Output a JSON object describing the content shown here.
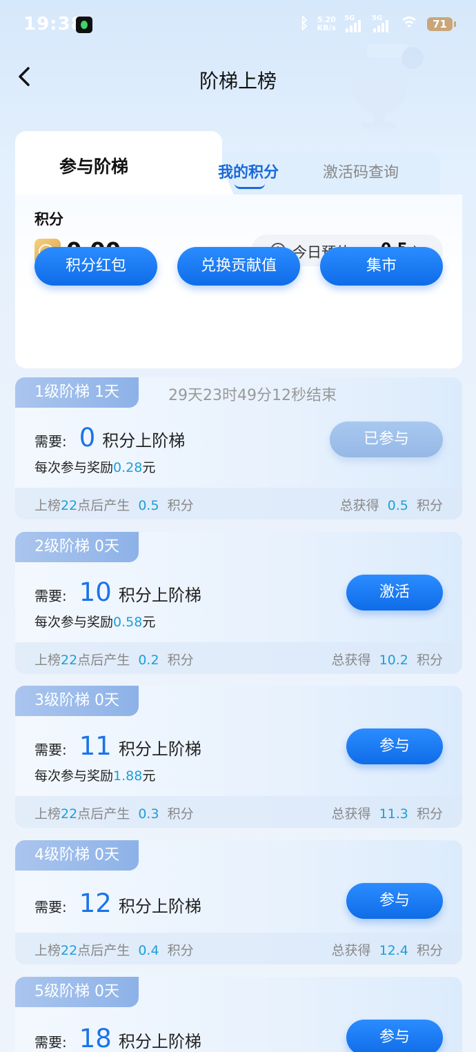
{
  "status": {
    "time": "19:38",
    "speed_top": "5.20",
    "speed_bottom": "KB/s",
    "sig1": "5G",
    "sig2": "5G",
    "battery": "71"
  },
  "header": {
    "title": "阶梯上榜"
  },
  "tabs": [
    "参与阶梯",
    "我的积分",
    "激活码查询"
  ],
  "score": {
    "label": "积分",
    "value": "0.00",
    "estimate_label": "今日预估",
    "estimate_value": "0.5"
  },
  "actions": [
    "积分红包",
    "兑换贡献值",
    "集市"
  ],
  "common": {
    "need_label": "需要:",
    "need_suffix": "积分上阶梯",
    "reward_prefix": "每次参与奖励",
    "reward_unit": "元",
    "foot_prefix": "上榜",
    "foot_hour": "22",
    "foot_mid": "点后产生",
    "unit": "积分",
    "total_label": "总获得"
  },
  "levels": [
    {
      "tag": "1级阶梯  1天",
      "countdown": "29天23时49分12秒结束",
      "need": "0",
      "reward": "0.28",
      "button": "已参与",
      "produce": "0.5",
      "total": "0.5"
    },
    {
      "tag": "2级阶梯  0天",
      "need": "10",
      "reward": "0.58",
      "button": "激活",
      "produce": "0.2",
      "total": "10.2"
    },
    {
      "tag": "3级阶梯  0天",
      "need": "11",
      "reward": "1.88",
      "button": "参与",
      "produce": "0.3",
      "total": "11.3"
    },
    {
      "tag": "4级阶梯  0天",
      "need": "12",
      "button": "参与",
      "produce": "0.4",
      "total": "12.4"
    },
    {
      "tag": "5级阶梯  0天",
      "need": "18",
      "button": "参与"
    }
  ],
  "colors": {
    "primary": "#1a74e8",
    "highlight": "#1a9fd8",
    "joined": "#a8c8ef"
  }
}
